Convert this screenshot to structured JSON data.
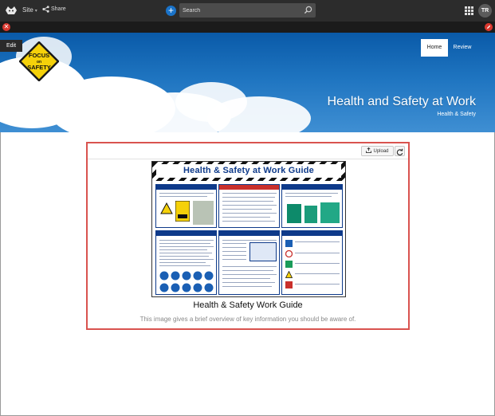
{
  "topbar": {
    "site_label": "Site",
    "share_label": "Share",
    "search_placeholder": "Search",
    "avatar_initials": "TR"
  },
  "edit": {
    "label": "Edit"
  },
  "banner": {
    "logo_lines": [
      "FOCUS",
      "on",
      "SAFETY"
    ],
    "nav": {
      "home": "Home",
      "review": "Review"
    },
    "title": "Health and Safety at Work",
    "breadcrumb": "Health & Safety"
  },
  "image_web_part": {
    "upload_label": "Upload",
    "poster_title": "Health & Safety at Work Guide",
    "caption": "Health & Safety Work Guide",
    "description": "This image gives a brief overview of key information you should be aware of."
  },
  "colors": {
    "accent": "#1a73c9",
    "selection_border": "#d9534f",
    "poster_blue": "#0e3a8a",
    "badge_yellow": "#f5d10a"
  }
}
